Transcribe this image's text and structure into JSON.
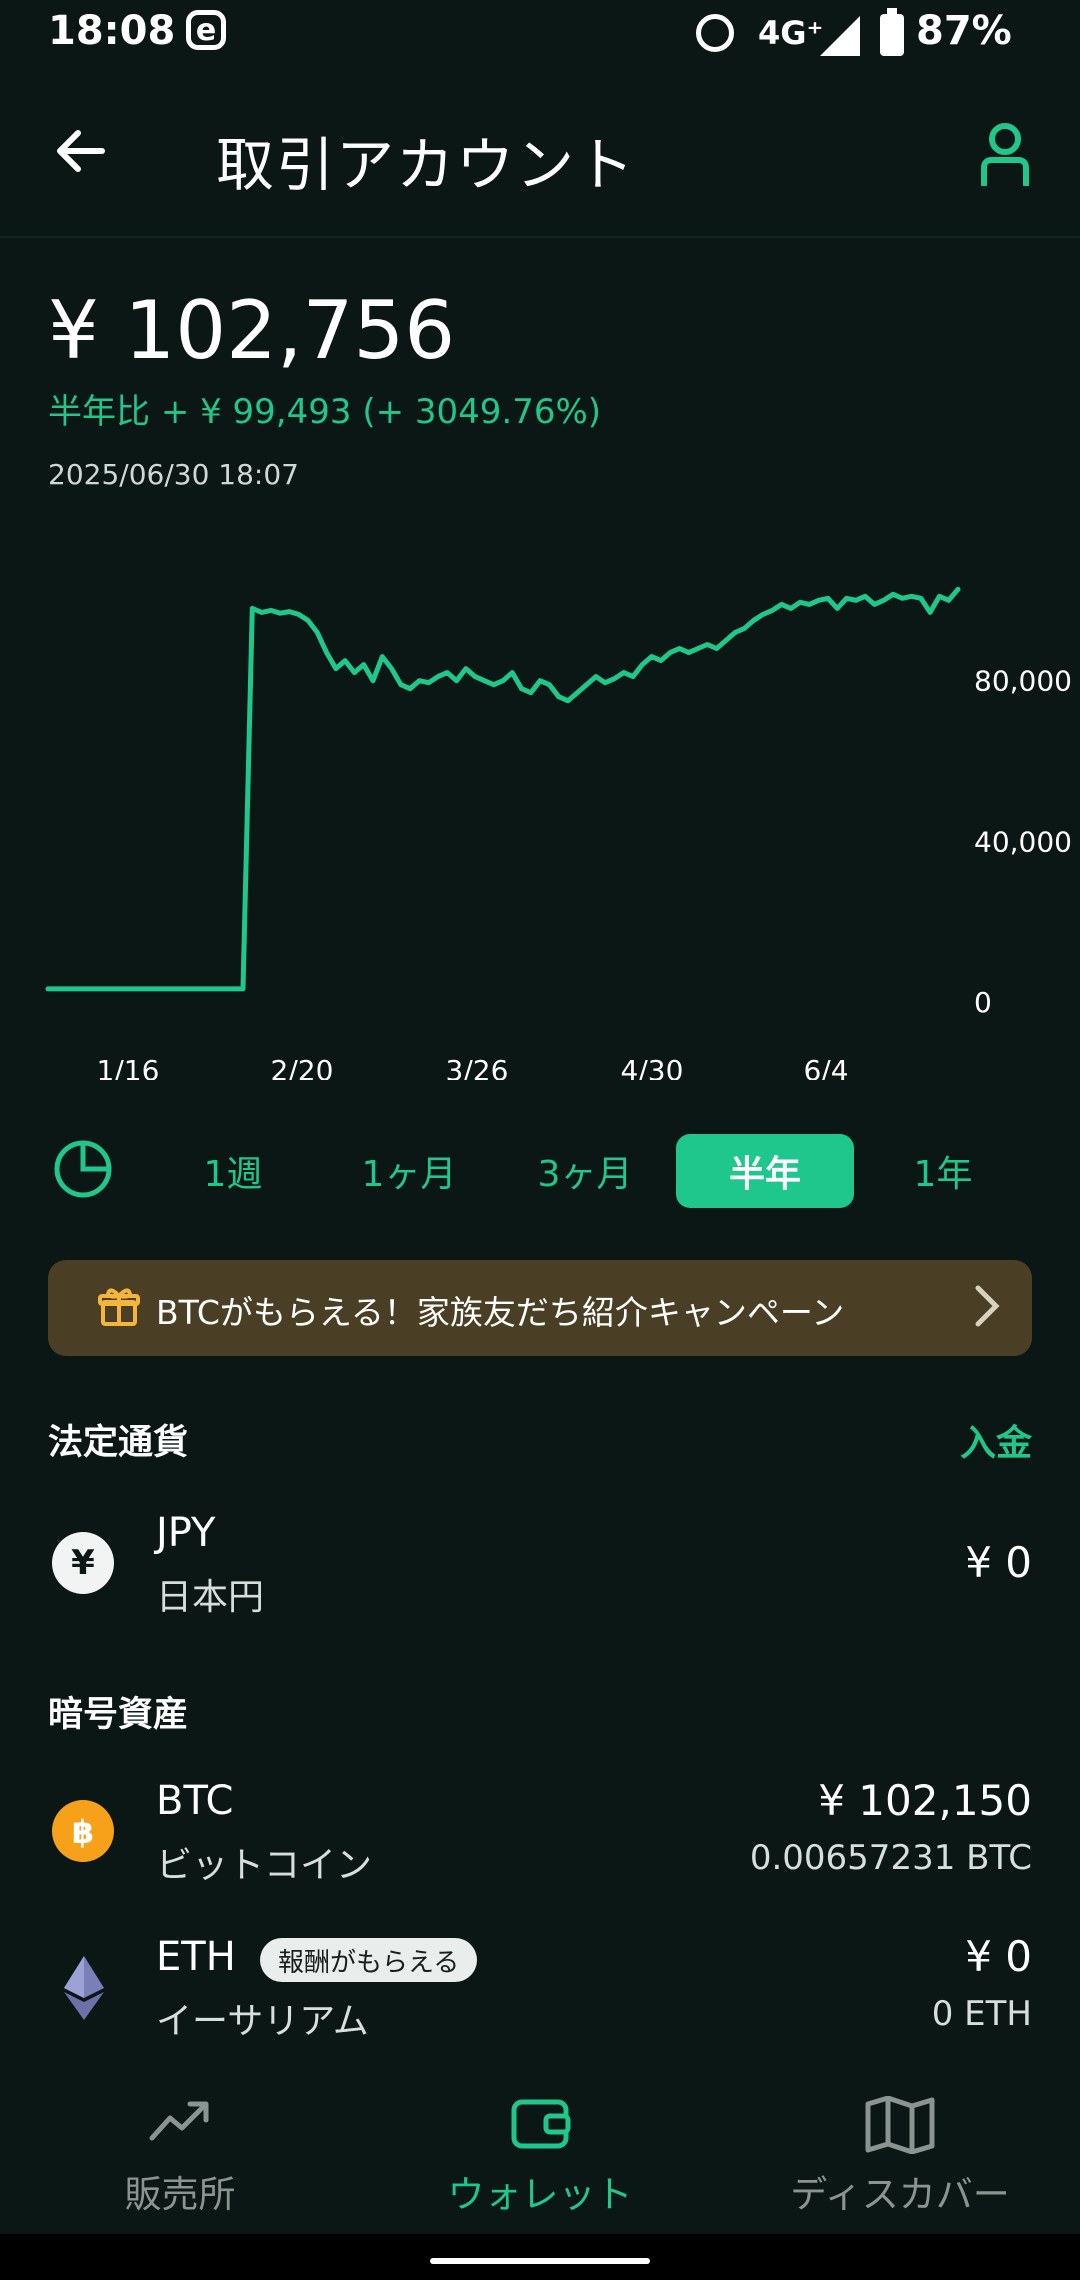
{
  "status_bar": {
    "time": "18:08",
    "app_icon": "e",
    "network": "4G⁺",
    "battery": "87%"
  },
  "header": {
    "title": "取引アカウント"
  },
  "balance": {
    "amount": "¥ 102,756",
    "change_label": "半年比",
    "change_value": "+ ¥ 99,493 (+ 3049.76%)",
    "timestamp": "2025/06/30 18:07"
  },
  "chart_data": {
    "type": "line",
    "x_ticks": [
      "1/16",
      "2/20",
      "3/26",
      "4/30",
      "6/4"
    ],
    "y_ticks": [
      "0",
      "40,000",
      "80,000"
    ],
    "ylim": [
      0,
      120000
    ],
    "series": [
      {
        "color": "#1fc78c",
        "values": [
          3260,
          3260,
          3260,
          3260,
          3260,
          3260,
          3260,
          3260,
          3260,
          3260,
          3260,
          3260,
          3260,
          3260,
          3260,
          3260,
          3260,
          3260,
          3260,
          3260,
          3260,
          3260,
          98000,
          97000,
          97500,
          96800,
          97200,
          96500,
          95000,
          92000,
          87000,
          83000,
          85000,
          82000,
          84000,
          80000,
          86000,
          83000,
          79000,
          78000,
          80000,
          79500,
          81000,
          82000,
          80000,
          83000,
          81000,
          80000,
          79000,
          80000,
          82000,
          78000,
          77000,
          80000,
          79000,
          76000,
          75000,
          77000,
          79000,
          81000,
          79500,
          80500,
          82000,
          81000,
          84000,
          86000,
          85000,
          87000,
          88000,
          87000,
          88000,
          89000,
          88000,
          90000,
          92000,
          93000,
          95000,
          96500,
          97500,
          99000,
          98000,
          99500,
          99000,
          100000,
          100500,
          98000,
          100500,
          100000,
          101000,
          99000,
          100000,
          101500,
          100500,
          101000,
          100500,
          97000,
          101000,
          100000,
          102756
        ]
      }
    ]
  },
  "periods": {
    "week": "1週",
    "month": "1ヶ月",
    "three_month": "3ヶ月",
    "half_year": "半年",
    "year": "1年",
    "active": "半年"
  },
  "banner": {
    "text": "BTCがもらえる！家族友だち紹介キャンペーン"
  },
  "fiat": {
    "section_title": "法定通貨",
    "deposit_label": "入金",
    "jpy": {
      "icon_glyph": "¥",
      "symbol": "JPY",
      "name": "日本円",
      "amount": "¥ 0"
    }
  },
  "crypto": {
    "section_title": "暗号資産",
    "btc": {
      "symbol": "BTC",
      "name": "ビットコイン",
      "amount": "¥ 102,150",
      "quantity": "0.00657231 BTC"
    },
    "eth": {
      "symbol": "ETH",
      "badge": "報酬がもらえる",
      "name": "イーサリアム",
      "amount": "¥ 0",
      "quantity": "0 ETH"
    }
  },
  "bottom_nav": {
    "exchange": "販売所",
    "wallet": "ウォレット",
    "discover": "ディスカバー",
    "active": "wallet"
  },
  "colors": {
    "accent": "#1fc78c",
    "background": "#0b1714",
    "banner": "#4a3f25",
    "btc": "#f7a11b"
  }
}
